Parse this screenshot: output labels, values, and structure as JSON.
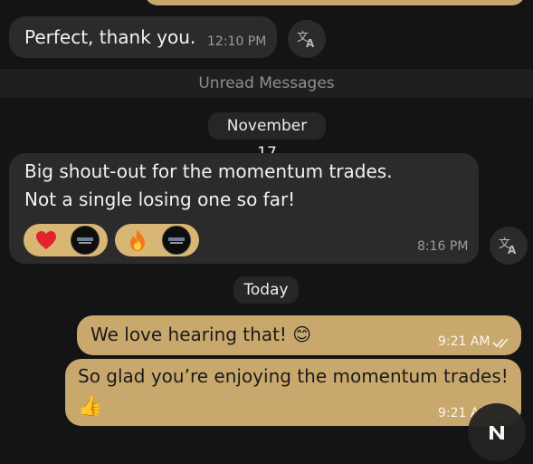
{
  "messages": {
    "perfect": {
      "text": "Perfect, thank you.",
      "time": "12:10 PM"
    },
    "shoutout": {
      "line1": "Big shout-out for the momentum trades.",
      "line2": "Not a single losing one so far!",
      "time": "8:16 PM",
      "reactions": [
        {
          "emoji": "heart",
          "glyph": "❤"
        },
        {
          "emoji": "fire",
          "glyph": "🔥"
        }
      ]
    },
    "love": {
      "text": "We love hearing that! 😊",
      "time": "9:21 AM"
    },
    "glad": {
      "text": "So glad you’re enjoying the momentum trades!",
      "emoji": "👍",
      "time": "9:21 AM"
    }
  },
  "separators": {
    "unread": "Unread Messages",
    "date_nov": "November 17",
    "date_today": "Today"
  },
  "colors": {
    "background": "#141414",
    "incoming_bubble": "#2b2b2b",
    "outgoing_bubble": "#c9a86e",
    "reaction_bg": "#d8b673"
  },
  "icons": {
    "translate": "translate-icon",
    "double_check": "double-check-icon",
    "fab": "app-logo-icon"
  }
}
